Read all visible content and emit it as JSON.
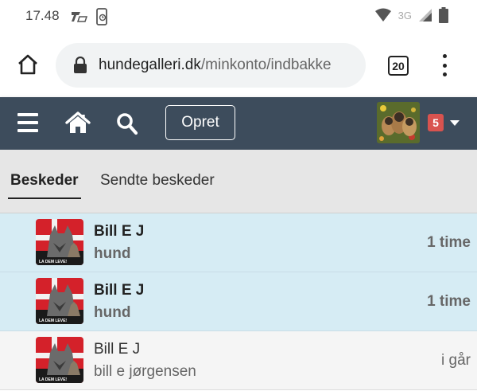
{
  "status_bar": {
    "time": "17.48",
    "network": "3G"
  },
  "browser": {
    "url_domain": "hundegalleri.dk",
    "url_path": "/minkonto/indbakke",
    "tab_count": "20"
  },
  "navbar": {
    "create_label": "Opret",
    "notification_count": "5",
    "colors": {
      "background": "#3d4c5c",
      "badge": "#d9534f"
    }
  },
  "tabs": {
    "messages_label": "Beskeder",
    "sent_label": "Sendte beskeder"
  },
  "messages": [
    {
      "sender": "Bill E J",
      "preview": "hund",
      "time": "1 time",
      "unread": true,
      "avatar_caption": "LA DEM LEVE!"
    },
    {
      "sender": "Bill E J",
      "preview": "hund",
      "time": "1 time",
      "unread": true,
      "avatar_caption": "LA DEM LEVE!"
    },
    {
      "sender": "Bill E J",
      "preview": "bill e jørgensen",
      "time": "i går",
      "unread": false,
      "avatar_caption": "LA DEM LEVE!"
    }
  ],
  "colors": {
    "unread_row": "#d6ecf4",
    "read_row": "#f5f5f5"
  }
}
